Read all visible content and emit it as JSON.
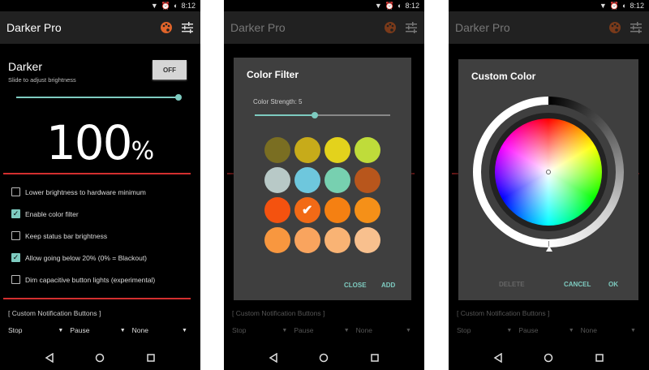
{
  "status": {
    "time": "8:12"
  },
  "app": {
    "title": "Darker Pro"
  },
  "main": {
    "heading": "Darker",
    "subheading": "Slide to adjust brightness",
    "toggle_label": "OFF",
    "brightness_value": "100",
    "brightness_unit": "%",
    "brightness_slider_fraction": 1.0,
    "options": [
      {
        "label": "Lower brightness to hardware minimum",
        "checked": false
      },
      {
        "label": "Enable color filter",
        "checked": true
      },
      {
        "label": "Keep status bar brightness",
        "checked": false
      },
      {
        "label": "Allow going below 20% (0% = Blackout)",
        "checked": true
      },
      {
        "label": "Dim capacitive button lights (experimental)",
        "checked": false
      }
    ],
    "custom_header": "[ Custom Notification Buttons ]",
    "dropdowns": [
      "Stop",
      "Pause",
      "None"
    ]
  },
  "color_filter_dialog": {
    "title": "Color Filter",
    "strength_label": "Color Strength: 5",
    "strength_fraction": 0.45,
    "swatches": [
      "#7a6e22",
      "#c7ab1a",
      "#e3d21c",
      "#bfdc3a",
      "#b8c9c7",
      "#6ec7dd",
      "#77d0b0",
      "#b8561c",
      "#f4520f",
      "#f26a16",
      "#f58012",
      "#f59018",
      "#f8973f",
      "#f9a45e",
      "#f9b374",
      "#f8c08e"
    ],
    "selected_index": 9,
    "close_label": "CLOSE",
    "add_label": "ADD"
  },
  "custom_color_dialog": {
    "title": "Custom Color",
    "delete_label": "DELETE",
    "cancel_label": "CANCEL",
    "ok_label": "OK"
  },
  "colors": {
    "accent": "#7ecbc0",
    "divider": "#d32f2f",
    "dialog_bg": "#3f3f3f",
    "appbar_bg": "#212121"
  },
  "icons": [
    "palette-icon",
    "tune-icon",
    "back-icon",
    "home-icon",
    "recents-icon"
  ]
}
